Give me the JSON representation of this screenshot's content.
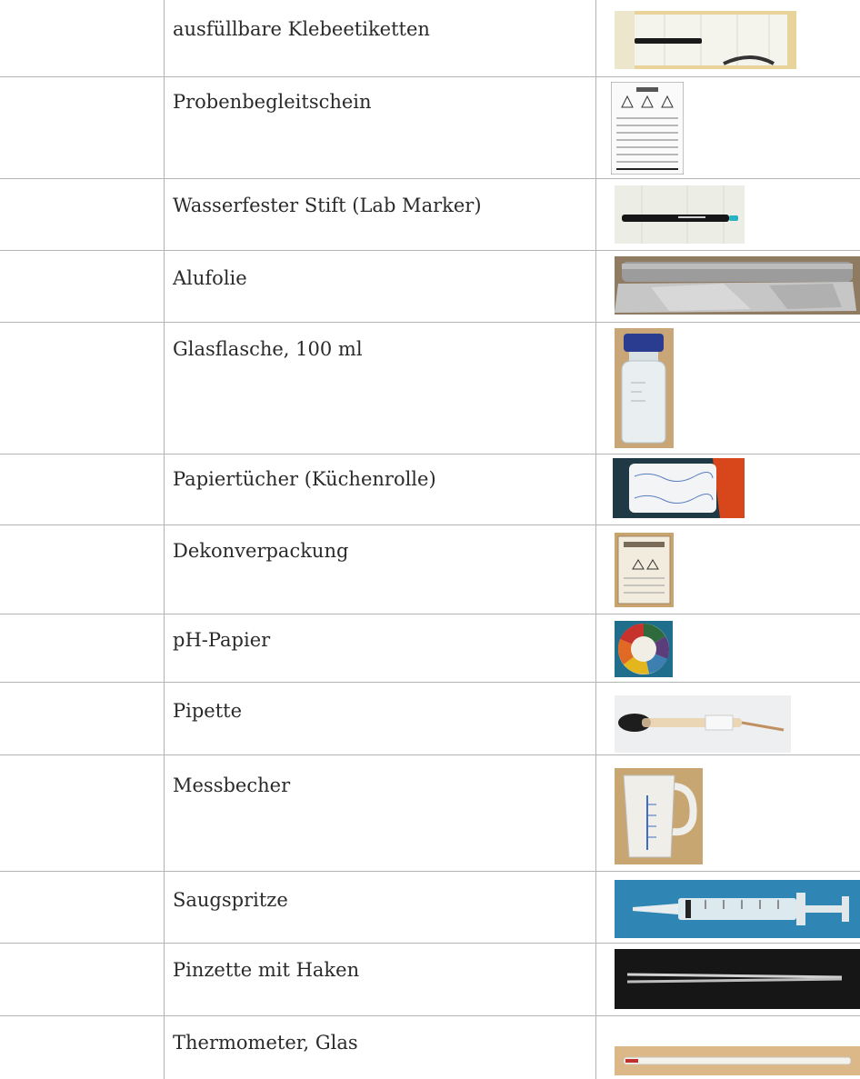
{
  "items": [
    {
      "label": "ausfüllbare Klebeetiketten",
      "image": "sticker-labels-with-pen-photo"
    },
    {
      "label": "Probenbegleitschein",
      "image": "sample-form-document-photo"
    },
    {
      "label": "Wasserfester Stift (Lab Marker)",
      "image": "lab-marker-photo"
    },
    {
      "label": "Alufolie",
      "image": "aluminium-foil-photo"
    },
    {
      "label": "Glasflasche, 100 ml",
      "image": "glass-bottle-photo"
    },
    {
      "label": "Papiertücher (Küchenrolle)",
      "image": "paper-towel-roll-photo"
    },
    {
      "label": "Dekonverpackung",
      "image": "decon-bag-photo"
    },
    {
      "label": "pH-Papier",
      "image": "ph-paper-photo"
    },
    {
      "label": "Pipette",
      "image": "pipette-photo"
    },
    {
      "label": "Messbecher",
      "image": "measuring-cup-photo"
    },
    {
      "label": "Saugspritze",
      "image": "syringe-photo"
    },
    {
      "label": "Pinzette mit Haken",
      "image": "tweezers-photo"
    },
    {
      "label": "Thermometer, Glas",
      "image": "glass-thermometer-photo"
    }
  ]
}
